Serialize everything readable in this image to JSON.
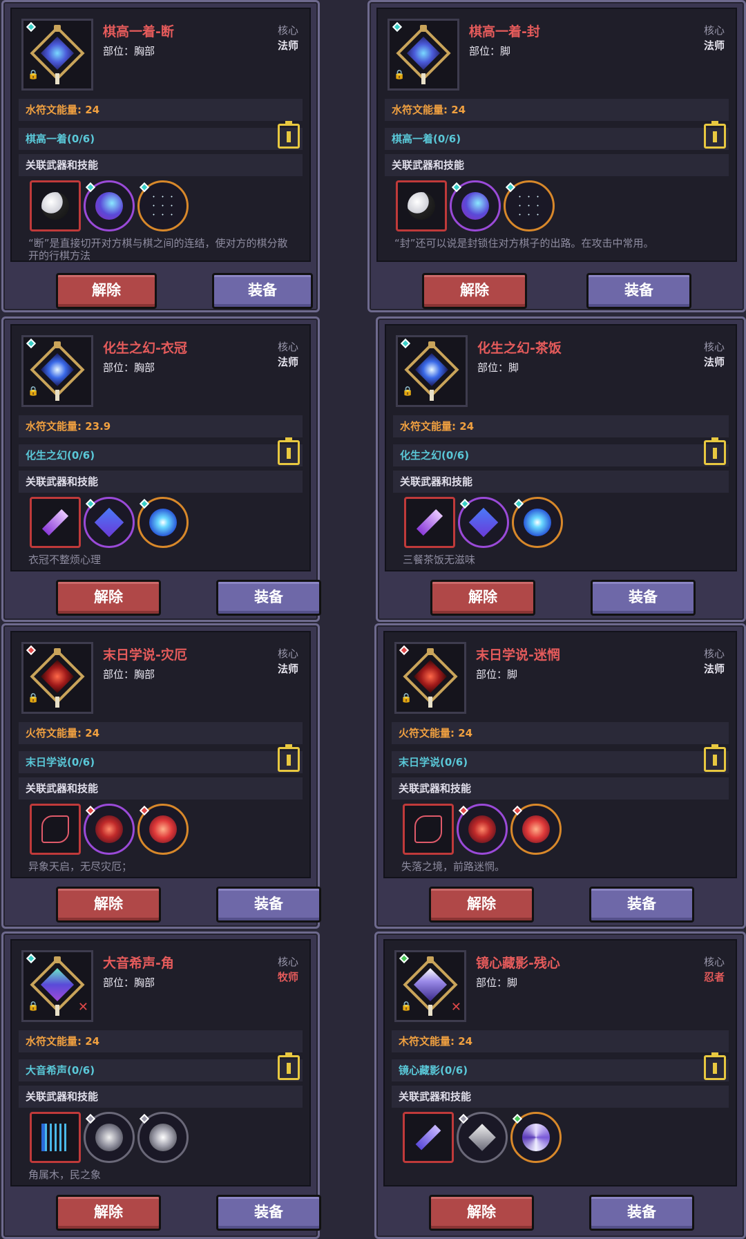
{
  "buttons": {
    "remove": "解除",
    "equip": "装备"
  },
  "cards": [
    {
      "title": "棋高一着-断",
      "slot": "部位：胸部",
      "core": "核心",
      "class": "法师",
      "energy": "水符文能量: 24",
      "set": "棋高一着(0/6)",
      "related": "关联武器和技能",
      "desc": "“断”是直接切开对方棋与棋之间的连结，使对方的棋分散开的行棋方法"
    },
    {
      "title": "棋高一着-封",
      "slot": "部位：脚",
      "core": "核心",
      "class": "法师",
      "energy": "水符文能量: 24",
      "set": "棋高一着(0/6)",
      "related": "关联武器和技能",
      "desc": "“封”还可以说是封锁住对方棋子的出路。在攻击中常用。"
    },
    {
      "title": "化生之幻-衣冠",
      "slot": "部位：胸部",
      "core": "核心",
      "class": "法师",
      "energy": "水符文能量: 23.9",
      "set": "化生之幻(0/6)",
      "related": "关联武器和技能",
      "desc": "衣冠不整烦心理"
    },
    {
      "title": "化生之幻-茶饭",
      "slot": "部位：脚",
      "core": "核心",
      "class": "法师",
      "energy": "水符文能量: 24",
      "set": "化生之幻(0/6)",
      "related": "关联武器和技能",
      "desc": "三餐茶饭无滋味"
    },
    {
      "title": "末日学说-灾厄",
      "slot": "部位：胸部",
      "core": "核心",
      "class": "法师",
      "energy": "火符文能量: 24",
      "set": "末日学说(0/6)",
      "related": "关联武器和技能",
      "desc": "异象天启，无尽灾厄；"
    },
    {
      "title": "末日学说-迷惘",
      "slot": "部位：脚",
      "core": "核心",
      "class": "法师",
      "energy": "火符文能量: 24",
      "set": "末日学说(0/6)",
      "related": "关联武器和技能",
      "desc": "失落之境，前路迷惘。"
    },
    {
      "title": "大音希声-角",
      "slot": "部位：胸部",
      "core": "核心",
      "class": "牧师",
      "energy": "水符文能量: 24",
      "set": "大音希声(0/6)",
      "related": "关联武器和技能",
      "desc": "角属木，民之象"
    },
    {
      "title": "镜心藏影-残心",
      "slot": "部位：脚",
      "core": "核心",
      "class": "忍者",
      "energy": "木符文能量: 24",
      "set": "镜心藏影(0/6)",
      "related": "关联武器和技能",
      "desc": ""
    }
  ],
  "colors": {
    "title_red": "#e55b5b",
    "energy_orange": "#f0a040",
    "set_cyan": "#5ac8d8",
    "remove_button": "#b04848",
    "equip_button": "#6e68a8"
  },
  "icons": [
    "gem-icon",
    "lock-icon",
    "emblem-icon",
    "clipboard-icon",
    "weapon-icon",
    "skill-icon",
    "x-mark-icon"
  ]
}
